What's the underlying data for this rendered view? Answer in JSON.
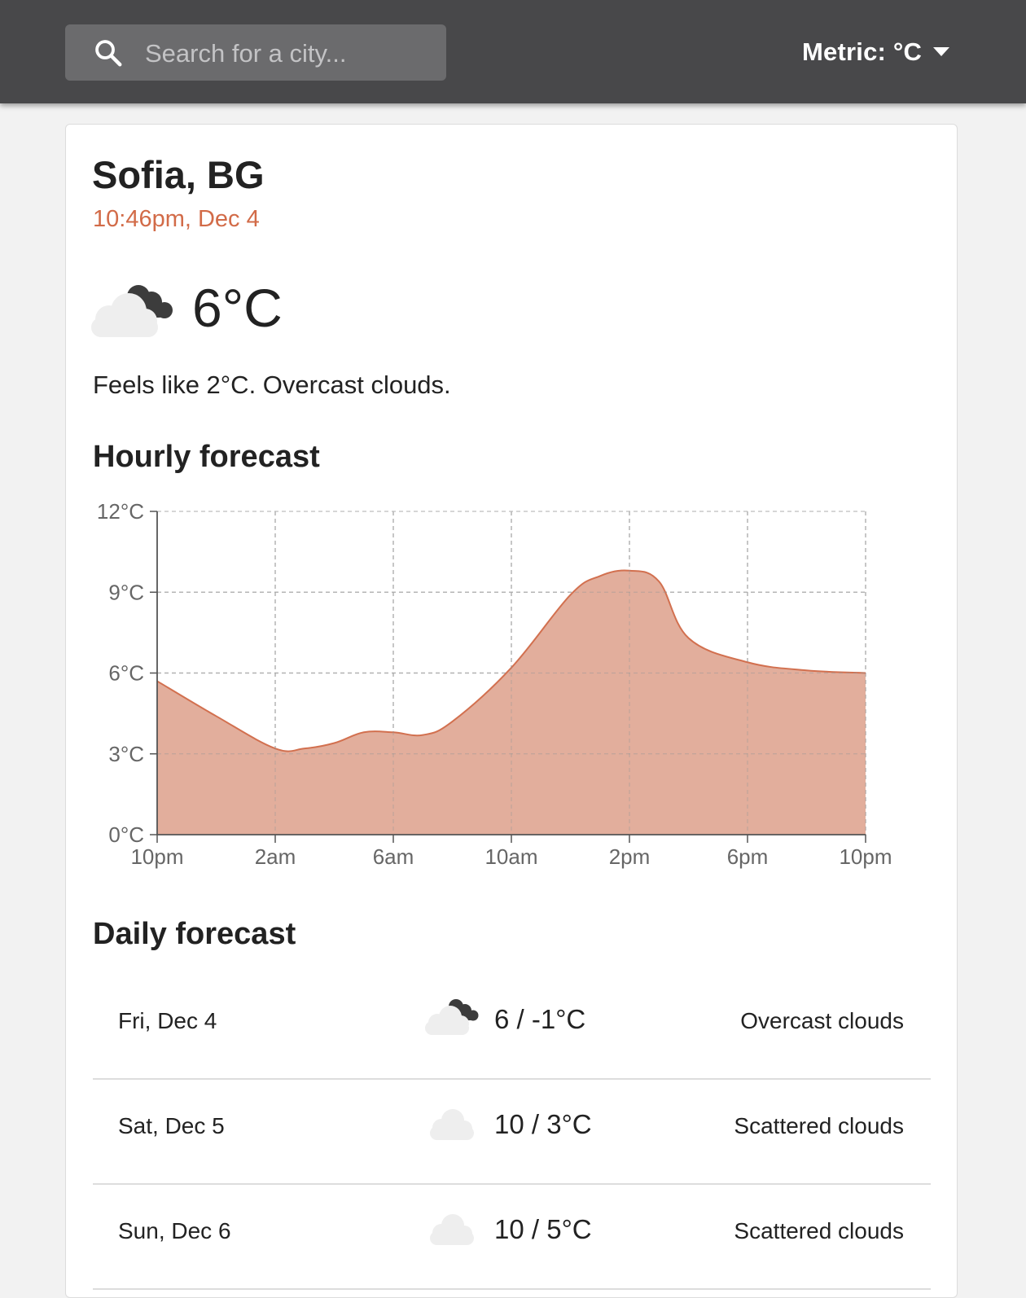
{
  "header": {
    "search_placeholder": "Search for a city...",
    "units_label": "Metric: °C"
  },
  "current": {
    "location": "Sofia, BG",
    "datetime": "10:46pm, Dec 4",
    "temperature": "6°C",
    "summary": "Feels like 2°C. Overcast clouds.",
    "icon": "overcast-clouds-icon"
  },
  "hourly": {
    "title": "Hourly forecast",
    "fill_color": "#e2ae9c",
    "line_color": "#d2704f"
  },
  "chart_data": {
    "type": "area",
    "x": [
      "10pm",
      "12am",
      "2am",
      "3am",
      "4am",
      "5am",
      "6am",
      "7am",
      "8am",
      "10am",
      "12pm",
      "1pm",
      "2pm",
      "3pm",
      "4pm",
      "6pm",
      "8pm",
      "10pm"
    ],
    "y": [
      5.7,
      4.4,
      3.2,
      3.2,
      3.4,
      3.8,
      3.8,
      3.7,
      4.2,
      6.2,
      8.9,
      9.6,
      9.8,
      9.4,
      7.3,
      6.4,
      6.1,
      6.0
    ],
    "xticks": [
      "10pm",
      "2am",
      "6am",
      "10am",
      "2pm",
      "6pm",
      "10pm"
    ],
    "yticks": [
      "0°C",
      "3°C",
      "6°C",
      "9°C",
      "12°C"
    ],
    "ylim": [
      0,
      12
    ],
    "grid": true
  },
  "daily": {
    "title": "Daily forecast",
    "rows": [
      {
        "day": "Fri, Dec 4",
        "range": "6 / -1°C",
        "desc": "Overcast clouds",
        "icon": "overcast-clouds-icon"
      },
      {
        "day": "Sat, Dec 5",
        "range": "10 / 3°C",
        "desc": "Scattered clouds",
        "icon": "scattered-clouds-icon"
      },
      {
        "day": "Sun, Dec 6",
        "range": "10 / 5°C",
        "desc": "Scattered clouds",
        "icon": "scattered-clouds-icon"
      }
    ]
  }
}
